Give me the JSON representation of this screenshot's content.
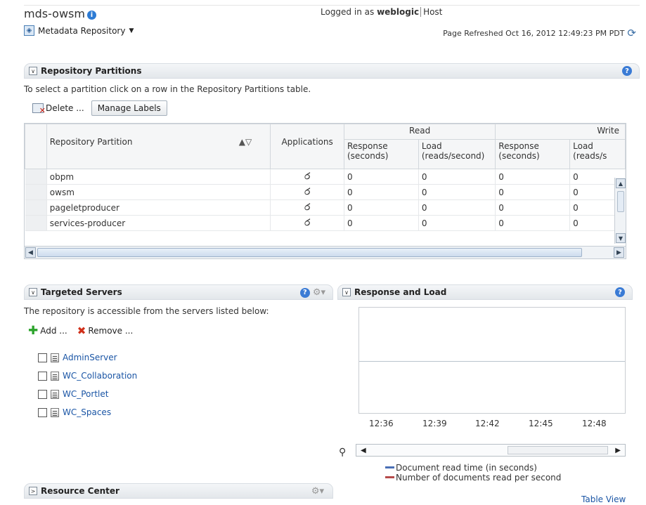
{
  "header": {
    "title": "mds-owsm",
    "logged_in_prefix": "Logged in as",
    "user": "weblogic",
    "host_label": "Host",
    "menu_label": "Metadata Repository",
    "refreshed": "Page Refreshed Oct 16, 2012 12:49:23 PM PDT"
  },
  "repo": {
    "title": "Repository Partitions",
    "intro": "To select a partition click on a row in the Repository Partitions table.",
    "delete_label": "Delete ...",
    "manage_labels": "Manage Labels",
    "columns": {
      "partition": "Repository Partition",
      "applications": "Applications",
      "read": "Read",
      "write": "Write",
      "read_response": "Response (seconds)",
      "read_load": "Load (reads/second)",
      "write_response": "Response (seconds)",
      "write_load": "Load (reads/s"
    },
    "rows": [
      {
        "name": "obpm",
        "read_resp": "0",
        "read_load": "0",
        "write_resp": "0",
        "write_load": "0"
      },
      {
        "name": "owsm",
        "read_resp": "0",
        "read_load": "0",
        "write_resp": "0",
        "write_load": "0"
      },
      {
        "name": "pageletproducer",
        "read_resp": "0",
        "read_load": "0",
        "write_resp": "0",
        "write_load": "0"
      },
      {
        "name": "services-producer",
        "read_resp": "0",
        "read_load": "0",
        "write_resp": "0",
        "write_load": "0"
      }
    ]
  },
  "servers": {
    "title": "Targeted Servers",
    "intro": "The repository is accessible from the servers listed below:",
    "add_label": "Add ...",
    "remove_label": "Remove ...",
    "items": [
      "AdminServer",
      "WC_Collaboration",
      "WC_Portlet",
      "WC_Spaces"
    ]
  },
  "resource_center": {
    "title": "Resource Center"
  },
  "response_load": {
    "title": "Response and Load",
    "x_ticks": [
      "12:36",
      "12:39",
      "12:42",
      "12:45",
      "12:48"
    ],
    "legend": [
      {
        "label": "Document read time (in seconds)",
        "color": "#4a6fb5"
      },
      {
        "label": "Number of documents read per second",
        "color": "#b54a4a"
      }
    ],
    "table_view": "Table View"
  }
}
